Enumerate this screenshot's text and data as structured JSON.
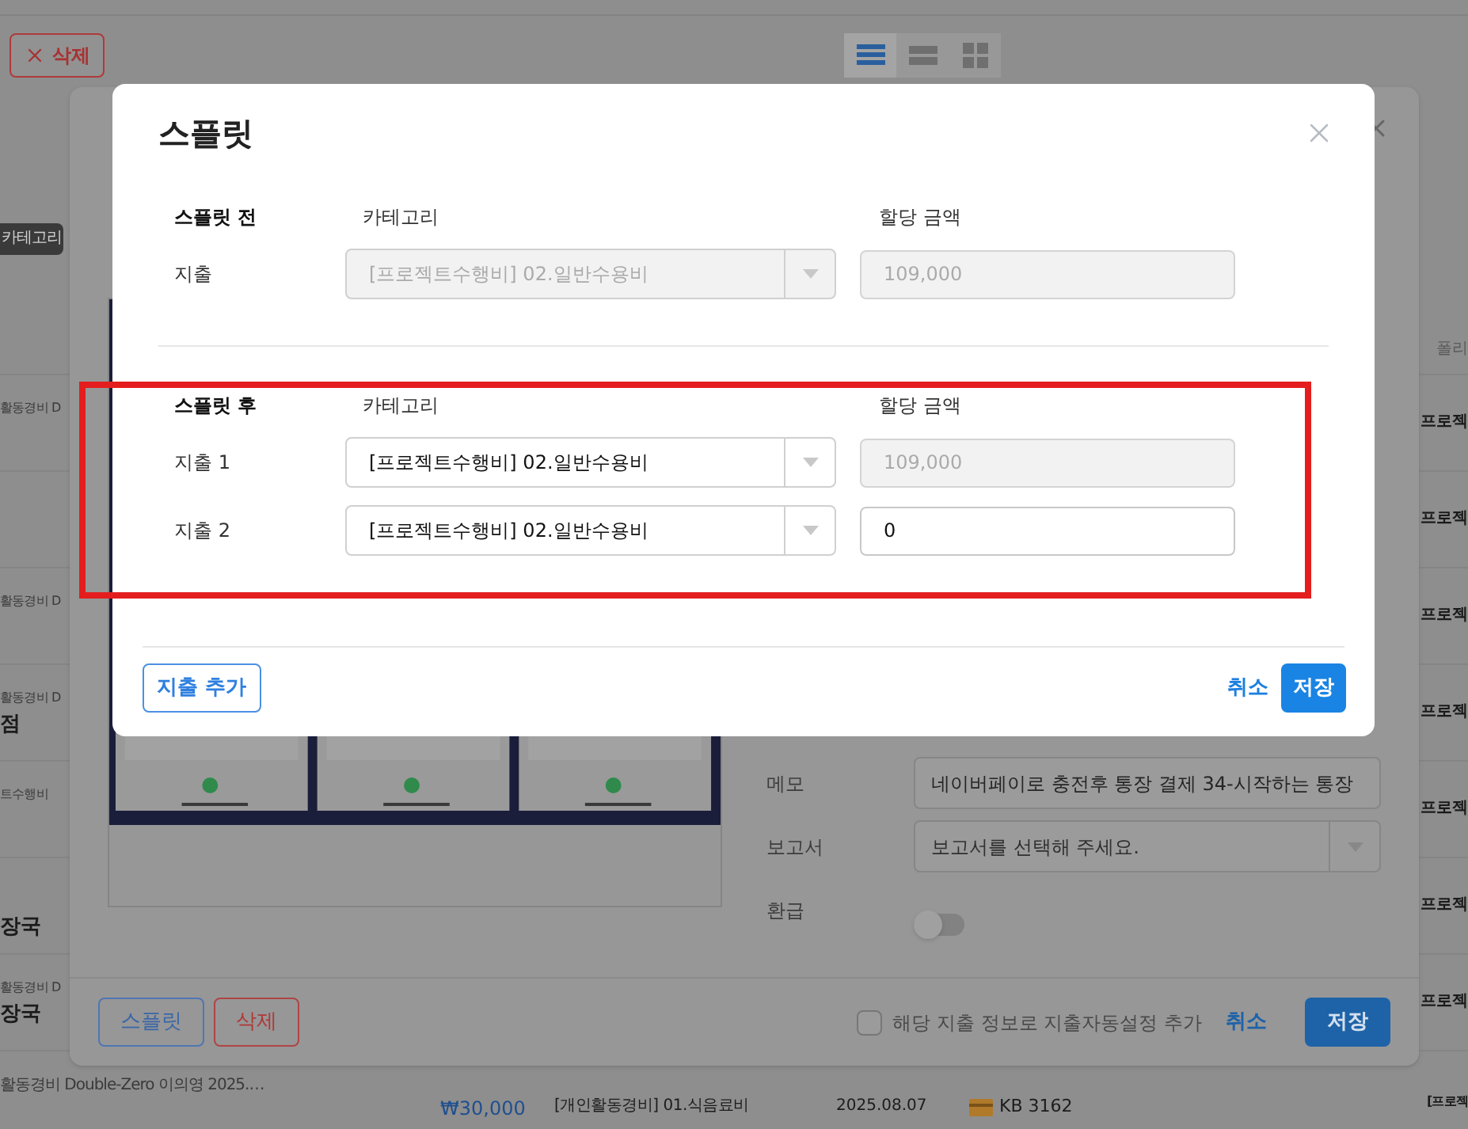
{
  "page": {
    "delete_button": {
      "label": "삭제"
    },
    "view_options": [
      {
        "selected": true
      },
      {
        "selected": false
      },
      {
        "selected": false
      }
    ],
    "category_tag": "카테고리",
    "column_header": "폴리",
    "rows": [
      {
        "left_line1": "활동경비 D",
        "right": "프로젝"
      },
      {
        "right": "프로젝"
      },
      {
        "left_line1": "활동경비 D",
        "right": "프로젝"
      },
      {
        "left_line1": "활동경비 D",
        "left_line2": "점",
        "right": "프로젝"
      },
      {
        "left_line1": "트수행비",
        "right": "프로젝"
      },
      {
        "left_line2": "장국",
        "right": "프로젝"
      },
      {
        "left_line1": "활동경비 D",
        "left_line2": "장국",
        "right": "프로젝"
      }
    ],
    "bottom_row": {
      "left": "활동경비 Double-Zero 이의영 2025.…",
      "amount": "₩30,000",
      "category": "[개인활동경비] 01.식음료비",
      "date": "2025.08.07",
      "card": "KB 3162",
      "right": "[프로젝"
    }
  },
  "detail_dialog": {
    "fields": [
      {
        "label": "메모",
        "kind": "text",
        "value": "네이버페이로 충전후 통장 결제 34-시작하는 통장"
      },
      {
        "label": "보고서",
        "kind": "select",
        "placeholder": "보고서를 선택해 주세요."
      },
      {
        "label": "환급",
        "kind": "toggle",
        "on": false
      }
    ],
    "auto_setting": {
      "label": "해당 지출 정보로 지출자동설정 추가",
      "checked": false
    },
    "left_buttons": [
      {
        "label": "스플릿",
        "kind": "primary"
      },
      {
        "label": "삭제",
        "kind": "danger"
      }
    ],
    "cancel": "취소",
    "save": "저장"
  },
  "split_dialog": {
    "title": "스플릿",
    "sections": [
      {
        "heading": "스플릿 전",
        "category_header": "카테고리",
        "amount_header": "할당 금액",
        "highlighted": false,
        "rows": [
          {
            "label": "지출",
            "category": "[프로젝트수행비] 02.일반수용비",
            "category_disabled": true,
            "amount": "109,000",
            "amount_disabled": true
          }
        ]
      },
      {
        "heading": "스플릿 후",
        "category_header": "카테고리",
        "amount_header": "할당 금액",
        "highlighted": true,
        "rows": [
          {
            "label": "지출 1",
            "category": "[프로젝트수행비] 02.일반수용비",
            "category_disabled": false,
            "amount": "109,000",
            "amount_disabled": true
          },
          {
            "label": "지출 2",
            "category": "[프로젝트수행비] 02.일반수용비",
            "category_disabled": false,
            "amount": "0",
            "amount_disabled": false
          }
        ]
      }
    ],
    "add_button": "지출 추가",
    "cancel": "취소",
    "save": "저장"
  }
}
